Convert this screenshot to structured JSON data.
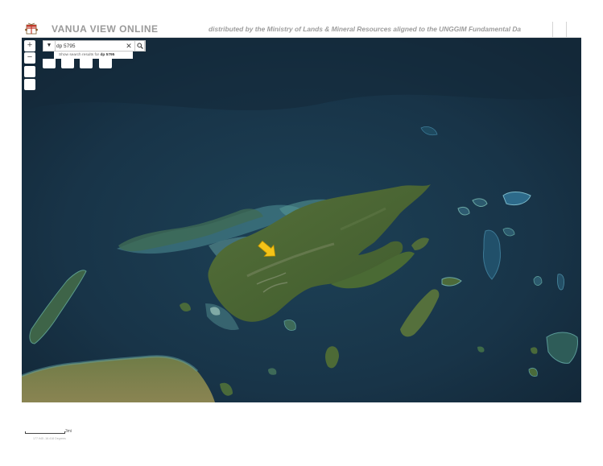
{
  "header": {
    "title": "VANUA VIEW ONLINE",
    "banner": "distributed by the Ministry of Lands & Mineral Resources aligned to the UNGGIM Fundamental Da"
  },
  "search": {
    "value": "dp 5795",
    "placeholder": "",
    "suggestion_prefix": "Show search results for",
    "suggestion_term": "dp 5795"
  },
  "controls": {
    "zoom_in_label": "+",
    "zoom_out_label": "−"
  },
  "scale": {
    "label": "3mi"
  },
  "coordinates": {
    "readout": "177.945 -16.418 Degrees"
  },
  "colors": {
    "ocean": "#183040",
    "land": "#4e6a36",
    "reef": "#5fa0a0",
    "marker": "#f3c318"
  },
  "icons": {
    "logo": "fiji-coat-of-arms-icon",
    "dropdown": "chevron-down-icon",
    "clear": "close-icon",
    "search": "search-icon",
    "marker": "location-arrow-icon"
  }
}
